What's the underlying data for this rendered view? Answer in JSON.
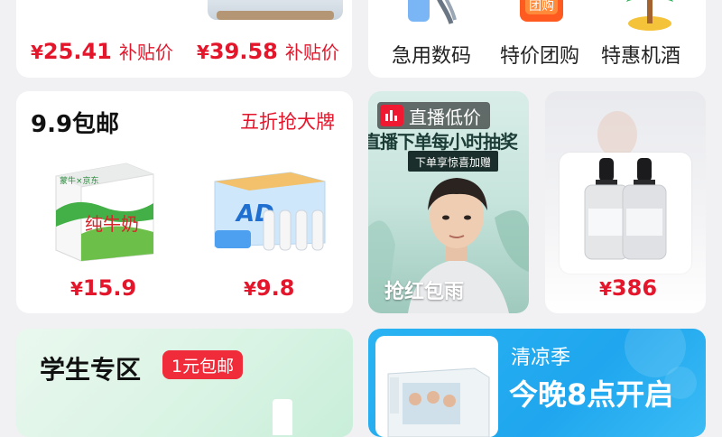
{
  "top_left_card": {
    "items": [
      {
        "currency": "¥",
        "price": "25.41",
        "tag": "补贴价"
      },
      {
        "currency": "¥",
        "price": "39.58",
        "tag": "补贴价"
      }
    ]
  },
  "top_right_card": {
    "categories": [
      {
        "label": "急用数码",
        "icon": "phone-cable-icon"
      },
      {
        "label": "特价团购",
        "icon": "group-buy-icon"
      },
      {
        "label": "特惠机酒",
        "icon": "palm-tree-icon"
      }
    ]
  },
  "baoyou_card": {
    "title": "9.9包邮",
    "link": "五折抢大牌",
    "products": [
      {
        "name": "纯牛奶",
        "brand_mark": "蒙牛 × 京东",
        "currency": "¥",
        "price": "15.9"
      },
      {
        "name": "AD钙",
        "currency": "¥",
        "price": "9.8"
      }
    ]
  },
  "live_card": {
    "badge": "直播低价",
    "banner": "直播下单每小时抽奖",
    "sub_banner": "下单享惊喜加赠",
    "caption": "抢红包雨"
  },
  "serum_card": {
    "currency": "¥",
    "price": "386"
  },
  "student_card": {
    "title": "学生专区",
    "badge": "1元包邮"
  },
  "summer_card": {
    "title": "清凉季",
    "subtitle": "今晚8点开启"
  },
  "colors": {
    "accent_red": "#e4162b",
    "summer_blue": "#1fa6ee",
    "student_green": "#dff6e8"
  }
}
